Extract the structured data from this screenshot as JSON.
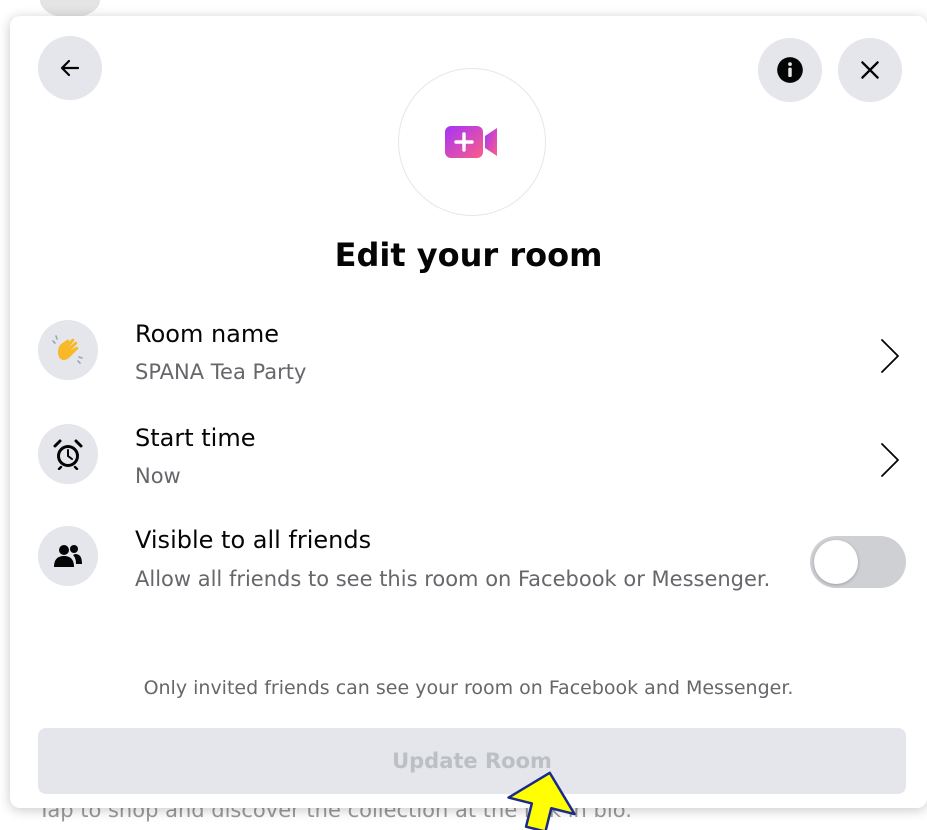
{
  "backdrop": {
    "caption": "Tap to shop and discover the collection at the link in bio."
  },
  "header": {
    "back_icon": "arrow-left-icon",
    "info_icon": "info-icon",
    "close_icon": "close-icon"
  },
  "hero": {
    "icon": "video-plus-icon"
  },
  "title": "Edit your room",
  "rows": {
    "room_name": {
      "label": "Room name",
      "value": "SPANA Tea Party",
      "icon": "waving-hand-icon"
    },
    "start_time": {
      "label": "Start time",
      "value": "Now",
      "icon": "alarm-clock-icon"
    },
    "visible": {
      "label": "Visible to all friends",
      "description": "Allow all friends to see this room on Facebook or Messenger.",
      "icon": "friends-icon",
      "enabled": false
    }
  },
  "note": "Only invited friends can see your room on Facebook and Messenger.",
  "update_button": {
    "label": "Update Room",
    "disabled": true
  },
  "colors": {
    "button_bg": "#e4e6eb",
    "toggle_off": "#ced0d4",
    "secondary_text": "#65676b",
    "accent_gradient_start": "#a334fa",
    "accent_gradient_end": "#ff5c87",
    "cursor_fill": "#ffff00"
  }
}
